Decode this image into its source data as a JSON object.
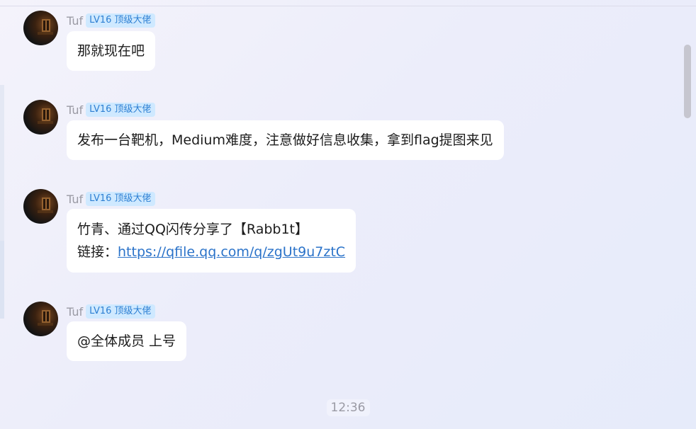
{
  "messages": [
    {
      "sender": "Tuf",
      "badge": "LV16 顶级大佬",
      "lines": [
        "那就现在吧"
      ]
    },
    {
      "sender": "Tuf",
      "badge": "LV16 顶级大佬",
      "lines": [
        "发布一台靶机，Medium难度，注意做好信息收集，拿到flag提图来见"
      ]
    },
    {
      "sender": "Tuf",
      "badge": "LV16 顶级大佬",
      "lines": [
        "竹青、通过QQ闪传分享了【Rabb1t】"
      ],
      "link_prefix": "链接：",
      "link_text": "https://qfile.qq.com/q/zgUt9u7ztC"
    },
    {
      "sender": "Tuf",
      "badge": "LV16 顶级大佬",
      "lines": [
        "@全体成员 上号"
      ]
    }
  ],
  "timestamp": "12:36",
  "avatar_icon": "avatar-photo-icon",
  "colors": {
    "badge_text": "#2d7fd3",
    "badge_bg": "#cfe9ff",
    "link": "#2b73c9",
    "bubble_bg": "#ffffff"
  }
}
